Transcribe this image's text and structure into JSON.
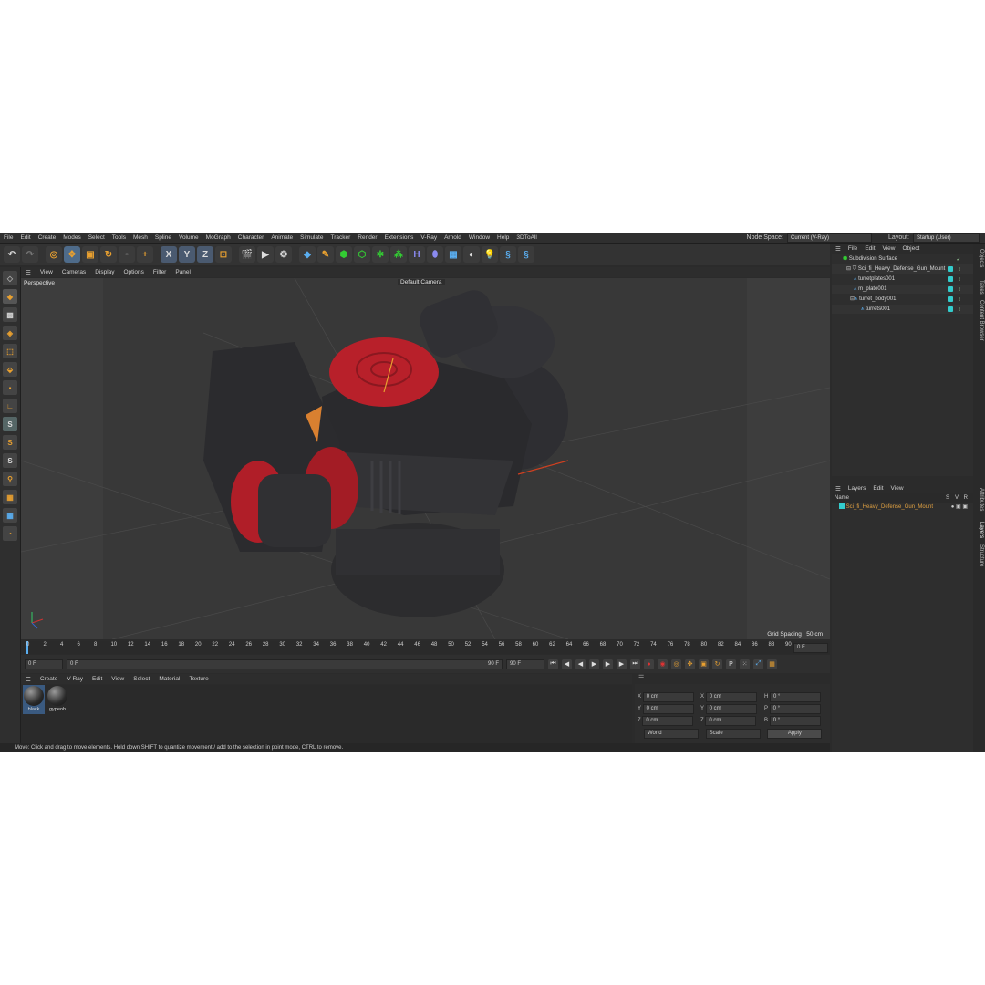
{
  "menubar": {
    "items": [
      "File",
      "Edit",
      "Create",
      "Modes",
      "Select",
      "Tools",
      "Mesh",
      "Spline",
      "Volume",
      "MoGraph",
      "Character",
      "Animate",
      "Simulate",
      "Tracker",
      "Render",
      "Extensions",
      "V-Ray",
      "Arnold",
      "Window",
      "Help",
      "3DToAll"
    ],
    "node_space_label": "Node Space:",
    "node_space_value": "Current (V-Ray)",
    "layout_label": "Layout:",
    "layout_value": "Startup (User)"
  },
  "toolbar": {
    "axis_x": "X",
    "axis_y": "Y",
    "axis_z": "Z"
  },
  "viewport": {
    "menu": [
      "View",
      "Cameras",
      "Display",
      "Options",
      "Filter",
      "Panel"
    ],
    "label": "Perspective",
    "camera": "Default Camera",
    "grid_spacing": "Grid Spacing : 50 cm"
  },
  "timeline": {
    "ticks": [
      "0",
      "2",
      "4",
      "6",
      "8",
      "10",
      "12",
      "14",
      "16",
      "18",
      "20",
      "22",
      "24",
      "26",
      "28",
      "30",
      "32",
      "34",
      "36",
      "38",
      "40",
      "42",
      "44",
      "46",
      "48",
      "50",
      "52",
      "54",
      "56",
      "58",
      "60",
      "62",
      "64",
      "66",
      "68",
      "70",
      "72",
      "74",
      "76",
      "78",
      "80",
      "82",
      "84",
      "86",
      "88",
      "90"
    ],
    "current_frame": "0 F"
  },
  "transport": {
    "start": "0 F",
    "current": "0 F",
    "end": "90 F",
    "end2": "90 F"
  },
  "materials": {
    "menu": [
      "Create",
      "V-Ray",
      "Edit",
      "View",
      "Select",
      "Material",
      "Texture"
    ],
    "items": [
      {
        "name": "black"
      },
      {
        "name": "gypeoh"
      }
    ]
  },
  "coordinates": {
    "rows": [
      {
        "a": "X",
        "av": "0 cm",
        "b": "X",
        "bv": "0 cm",
        "c": "H",
        "cv": "0 °"
      },
      {
        "a": "Y",
        "av": "0 cm",
        "b": "Y",
        "bv": "0 cm",
        "c": "P",
        "cv": "0 °"
      },
      {
        "a": "Z",
        "av": "0 cm",
        "b": "Z",
        "bv": "0 cm",
        "c": "B",
        "cv": "0 °"
      }
    ],
    "mode": "World",
    "size_mode": "Scale",
    "apply": "Apply"
  },
  "status": "Move: Click and drag to move elements. Hold down SHIFT to quantize movement / add to the selection in point mode, CTRL to remove.",
  "objects": {
    "menu": [
      "File",
      "Edit",
      "View",
      "Object"
    ],
    "items": [
      {
        "name": "Subdivision Surface"
      },
      {
        "name": "Sci_fi_Heavy_Defense_Gun_Mount"
      },
      {
        "name": "turretplates001"
      },
      {
        "name": "m_plate001"
      },
      {
        "name": "turret_body001"
      },
      {
        "name": "turrets001"
      }
    ]
  },
  "layers": {
    "menu": [
      "Layers",
      "Edit",
      "View"
    ],
    "header_name": "Name",
    "header_s": "S",
    "header_v": "V",
    "header_r": "R",
    "item": "Sci_fi_Heavy_Defense_Gun_Mount"
  },
  "sidetabs": [
    "Objects",
    "Takes",
    "Content Browser",
    "Attributes",
    "Layers",
    "Structure"
  ],
  "colors": {
    "accent_tag": "#33cccc",
    "layer_text": "#e0a040",
    "model_red": "#c0202a"
  }
}
